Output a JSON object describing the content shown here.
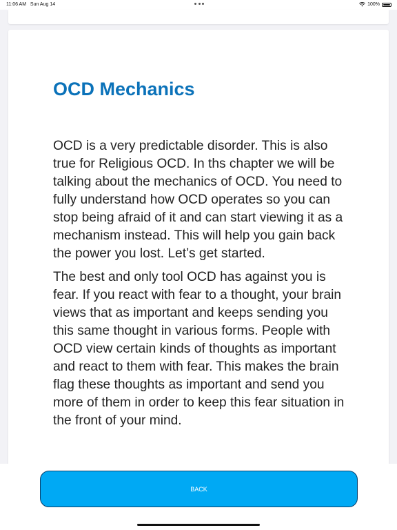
{
  "status_bar": {
    "time": "11:06 AM",
    "date": "Sun Aug 14",
    "battery": "100%",
    "wifi_icon": "wifi-icon",
    "battery_icon": "battery-icon",
    "multitasking_icon": "more-dots-icon"
  },
  "chapter": {
    "title": "OCD Mechanics",
    "paragraphs": [
      "OCD is a very predictable disorder. This is also true for Religious OCD. In ths chapter we will be talking about the mechanics of OCD. You need to fully understand how OCD operates so you can stop being afraid of it and can start viewing it as a mechanism instead. This will help you gain back the power you lost. Let’s get started.",
      "The best and only tool OCD has against you is fear. If you react with fear to a thought, your brain views that as important and keeps sending you this same thought in various forms. People with OCD view certain kinds of thoughts as important and react to them with fear. This makes the brain flag these thoughts as important and send you more of them in order to keep this fear situation in the front of your mind."
    ]
  },
  "back_button": {
    "label": "BACK"
  },
  "colors": {
    "title": "#0b72b9",
    "button": "#00a9f4",
    "button_text": "#ffffff",
    "background": "#f2f2f6"
  }
}
